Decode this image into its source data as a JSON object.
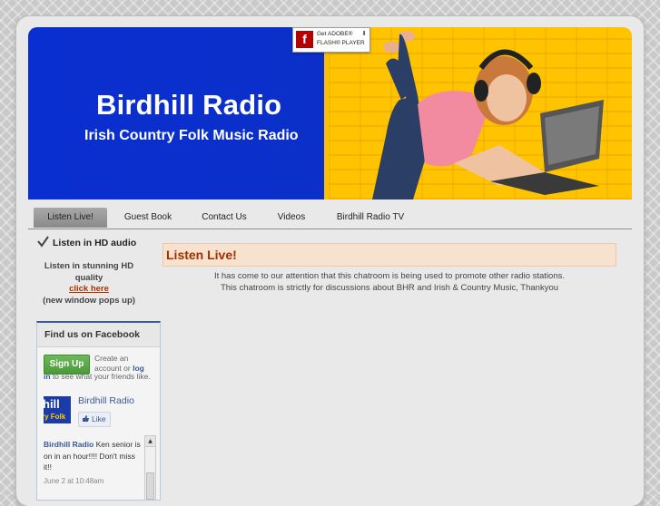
{
  "site": {
    "title": "Birdhill Radio",
    "subtitle": "Irish Country Folk Music Radio"
  },
  "flash_badge": {
    "line1": "Get ADOBE®",
    "line2": "FLASH® PLAYER",
    "icon": "flash-icon"
  },
  "nav": {
    "items": [
      {
        "label": "Listen Live!",
        "active": true
      },
      {
        "label": "Guest Book",
        "active": false
      },
      {
        "label": "Contact Us",
        "active": false
      },
      {
        "label": "Videos",
        "active": false
      },
      {
        "label": "Birdhill Radio TV",
        "active": false
      }
    ]
  },
  "sidebar": {
    "hd_title": "Listen in HD audio",
    "hd_line1": "Listen in stunning HD",
    "hd_line2": "quality",
    "hd_link": "click here",
    "hd_note": "(new window pops up)"
  },
  "facebook": {
    "title": "Find us on Facebook",
    "signup": "Sign Up",
    "create1": "Create an",
    "create2": "account or",
    "login": "log",
    "login2": "in",
    "create3": "to see what your friends like.",
    "page_name": "Birdhill Radio",
    "page_pic_1": "hill",
    "page_pic_2": "ry Folk",
    "like": "Like",
    "post_author": "Birdhill Radio",
    "post_text": "Ken senior is on in an hour!!!! Don't miss it!!",
    "post_time": "June 2 at 10:48am"
  },
  "main": {
    "heading": "Listen Live!",
    "line1": "It has come to our attention that this chatroom is being used to promote other radio stations.",
    "line2": "This chatroom is strictly for discussions about BHR and Irish & Country Music, Thankyou"
  },
  "colors": {
    "banner_blue": "#0a2fd0",
    "banner_yellow": "#ffc400",
    "heading_red": "#a03000",
    "facebook_blue": "#3b5998",
    "signup_green": "#4a9a3a"
  }
}
